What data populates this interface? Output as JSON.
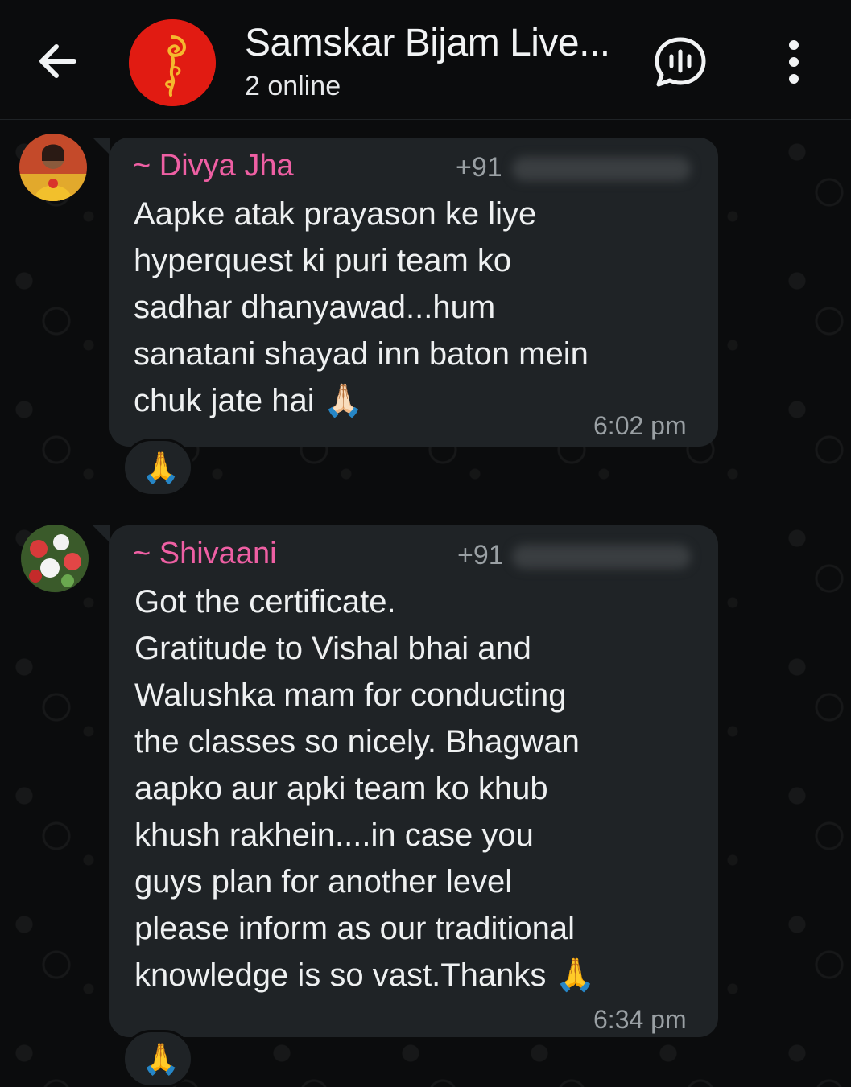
{
  "header": {
    "title": "Samskar Bijam Live...",
    "subtitle": "2 online",
    "icons": {
      "back": "arrow-left-icon",
      "voice_chat": "voice-chat-icon",
      "menu": "more-vert-icon"
    },
    "avatar_color": "#e11b12"
  },
  "messages": [
    {
      "sender": "~ Divya Jha",
      "phone_prefix": "+91",
      "text": "Aapke atak prayason ke liye\nhyperquest ki puri team ko\nsadhar dhanyawad...hum\nsanatani shayad inn baton mein\nchuk jate hai 🙏🏻",
      "time": "6:02 pm",
      "reaction": "🙏"
    },
    {
      "sender": "~ Shivaani",
      "phone_prefix": "+91",
      "text": "Got the certificate.\nGratitude to Vishal bhai and\nWalushka mam for conducting\nthe classes so nicely. Bhagwan\naapko aur apki team ko khub\nkhush rakhein....in case you\nguys plan for another level\nplease inform as our traditional\nknowledge is so vast.Thanks 🙏",
      "time": "6:34 pm",
      "reaction": "🙏"
    }
  ],
  "colors": {
    "background": "#0b0c0d",
    "bubble": "#1f2326",
    "sender_name": "#ee5fa3",
    "meta_text": "#9aa0a4"
  }
}
